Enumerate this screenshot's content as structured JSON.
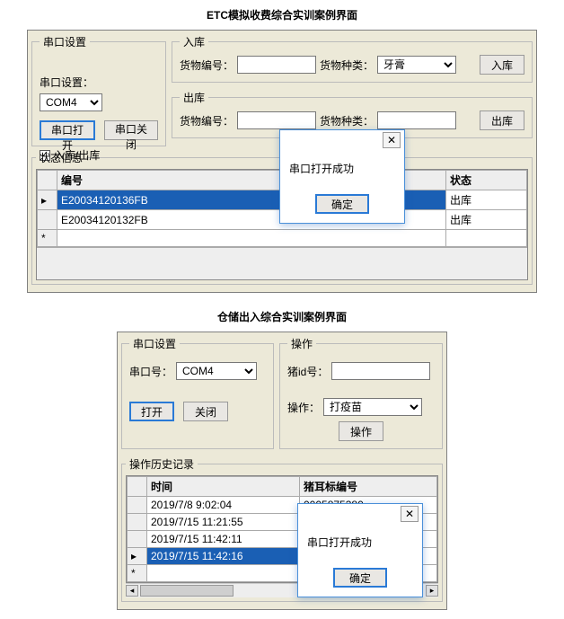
{
  "sec1": {
    "caption": "ETC模拟收费综合实训案例界面",
    "serial_group": "串口设置",
    "serial_label": "串口设置：",
    "com_value": "COM4",
    "open_btn": "串口打开",
    "close_btn": "串口关闭",
    "chk_label": "入库/出库",
    "in_group": "入库",
    "out_group": "出库",
    "goods_id": "货物编号：",
    "goods_kind": "货物种类：",
    "in_kind_value": "牙膏",
    "in_btn": "入库",
    "out_btn": "出库",
    "status_group": "状态信息",
    "col_id": "编号",
    "col_state": "状态",
    "rows": [
      {
        "id": "E20034120136FB",
        "state": "出库"
      },
      {
        "id": "E20034120132FB",
        "state": "出库"
      }
    ],
    "dialog_msg": "串口打开成功",
    "dialog_ok": "确定"
  },
  "sec2": {
    "caption": "仓储出入综合实训案例界面",
    "serial_group": "串口设置",
    "serial_label": "串口号：",
    "com_value": "COM4",
    "open_btn": "打开",
    "close_btn": "关闭",
    "op_group": "操作",
    "pig_id": "猪id号：",
    "op_label": "操作：",
    "op_value": "打疫苗",
    "op_btn": "操作",
    "history_group": "操作历史记录",
    "col_time": "时间",
    "col_ear": "猪耳标编号",
    "rows": [
      {
        "t": "2019/7/8 9:02:04",
        "ear": "0005875380"
      },
      {
        "t": "2019/7/15 11:21:55",
        "ear": ""
      },
      {
        "t": "2019/7/15 11:42:11",
        "ear": ""
      },
      {
        "t": "2019/7/15 11:42:16",
        "ear": ""
      }
    ],
    "dialog_msg": "串口打开成功",
    "dialog_ok": "确定"
  }
}
